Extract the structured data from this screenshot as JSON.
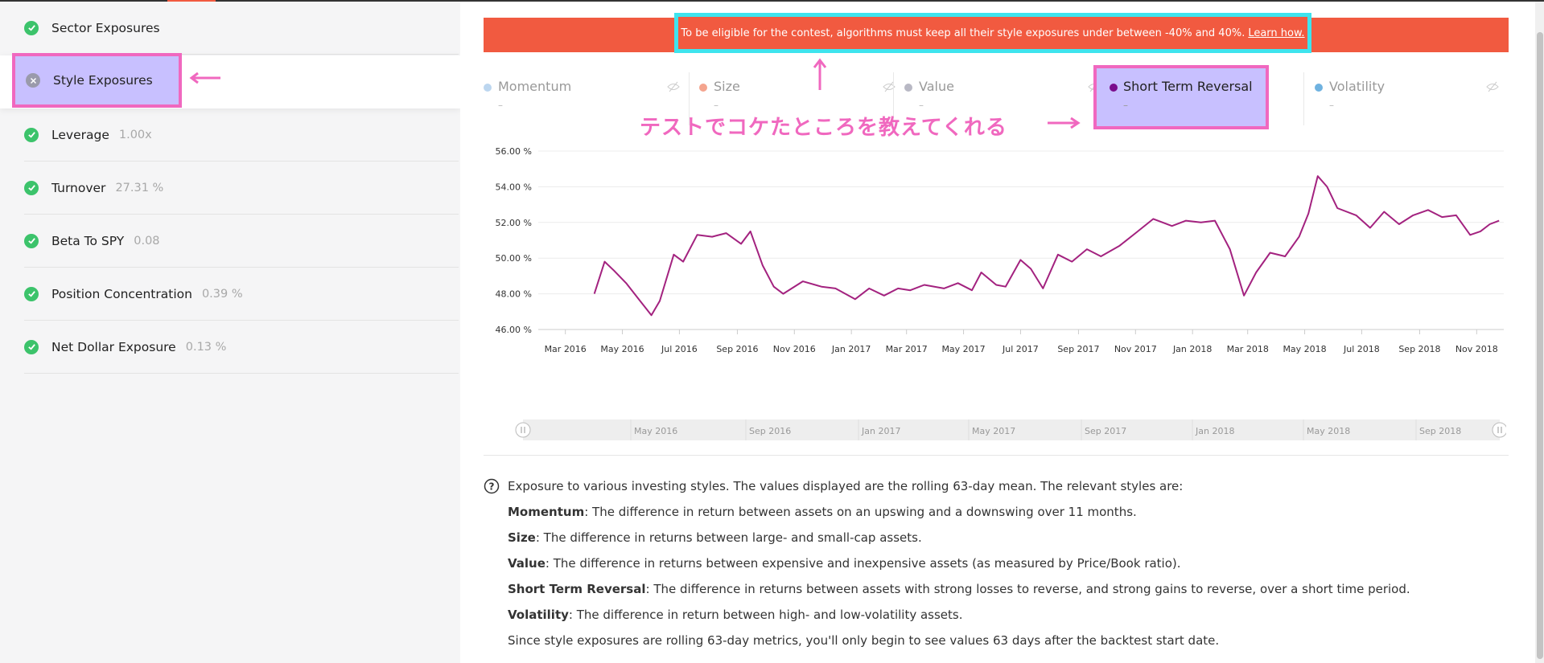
{
  "sidebar": {
    "items": [
      {
        "label": "Sector Exposures",
        "value": ""
      },
      {
        "label": "Style Exposures",
        "value": ""
      },
      {
        "label": "Leverage",
        "value": "1.00x"
      },
      {
        "label": "Turnover",
        "value": "27.31 %"
      },
      {
        "label": "Beta To SPY",
        "value": "0.08"
      },
      {
        "label": "Position Concentration",
        "value": "0.39 %"
      },
      {
        "label": "Net Dollar Exposure",
        "value": "0.13 %"
      }
    ]
  },
  "banner": {
    "text": "To be eligible for the contest, algorithms must keep all their style exposures under between -40% and 40%.",
    "link": "Learn how."
  },
  "tabs": [
    {
      "name": "Momentum",
      "value": "–",
      "color": "#bcd6ef"
    },
    {
      "name": "Size",
      "value": "–",
      "color": "#f4a48e"
    },
    {
      "name": "Value",
      "value": "–",
      "color": "#b8b8c4"
    },
    {
      "name": "Short Term Reversal",
      "value": "–",
      "color": "#7a0c8c"
    },
    {
      "name": "Volatility",
      "value": "–",
      "color": "#6fb2e0"
    }
  ],
  "annotation": {
    "jp_note": "テストでコケたところを教えてくれる"
  },
  "chart_data": {
    "type": "line",
    "title": "",
    "xlabel": "",
    "ylabel": "",
    "ylim": [
      46,
      56
    ],
    "y_ticks": [
      "46.00 %",
      "48.00 %",
      "50.00 %",
      "52.00 %",
      "54.00 %",
      "56.00 %"
    ],
    "x_ticks": [
      "Mar 2016",
      "May 2016",
      "Jul 2016",
      "Sep 2016",
      "Nov 2016",
      "Jan 2017",
      "Mar 2017",
      "May 2017",
      "Jul 2017",
      "Sep 2017",
      "Nov 2017",
      "Jan 2018",
      "Mar 2018",
      "May 2018",
      "Jul 2018",
      "Sep 2018",
      "Nov 2018"
    ],
    "series": [
      {
        "color": "#a3227f",
        "points": [
          [
            "2016-04-01",
            48.0
          ],
          [
            "2016-04-12",
            49.8
          ],
          [
            "2016-04-22",
            49.3
          ],
          [
            "2016-05-05",
            48.6
          ],
          [
            "2016-05-20",
            47.6
          ],
          [
            "2016-06-01",
            46.8
          ],
          [
            "2016-06-10",
            47.6
          ],
          [
            "2016-06-25",
            50.2
          ],
          [
            "2016-07-05",
            49.8
          ],
          [
            "2016-07-20",
            51.3
          ],
          [
            "2016-08-05",
            51.2
          ],
          [
            "2016-08-20",
            51.4
          ],
          [
            "2016-09-05",
            50.8
          ],
          [
            "2016-09-15",
            51.5
          ],
          [
            "2016-09-28",
            49.6
          ],
          [
            "2016-10-10",
            48.4
          ],
          [
            "2016-10-20",
            48.0
          ],
          [
            "2016-11-10",
            48.7
          ],
          [
            "2016-11-30",
            48.4
          ],
          [
            "2016-12-15",
            48.3
          ],
          [
            "2017-01-05",
            47.7
          ],
          [
            "2017-01-20",
            48.3
          ],
          [
            "2017-02-05",
            47.9
          ],
          [
            "2017-02-20",
            48.3
          ],
          [
            "2017-03-05",
            48.2
          ],
          [
            "2017-03-20",
            48.5
          ],
          [
            "2017-04-10",
            48.3
          ],
          [
            "2017-04-25",
            48.6
          ],
          [
            "2017-05-10",
            48.2
          ],
          [
            "2017-05-20",
            49.2
          ],
          [
            "2017-06-05",
            48.5
          ],
          [
            "2017-06-15",
            48.4
          ],
          [
            "2017-07-01",
            49.9
          ],
          [
            "2017-07-12",
            49.4
          ],
          [
            "2017-07-25",
            48.3
          ],
          [
            "2017-08-10",
            50.2
          ],
          [
            "2017-08-25",
            49.8
          ],
          [
            "2017-09-10",
            50.5
          ],
          [
            "2017-09-25",
            50.1
          ],
          [
            "2017-10-15",
            50.7
          ],
          [
            "2017-11-01",
            51.4
          ],
          [
            "2017-11-20",
            52.2
          ],
          [
            "2017-12-10",
            51.8
          ],
          [
            "2017-12-25",
            52.1
          ],
          [
            "2018-01-10",
            52.0
          ],
          [
            "2018-01-25",
            52.1
          ],
          [
            "2018-02-10",
            50.5
          ],
          [
            "2018-02-25",
            47.9
          ],
          [
            "2018-03-10",
            49.2
          ],
          [
            "2018-03-25",
            50.3
          ],
          [
            "2018-04-10",
            50.1
          ],
          [
            "2018-04-25",
            51.2
          ],
          [
            "2018-05-05",
            52.5
          ],
          [
            "2018-05-15",
            54.6
          ],
          [
            "2018-05-25",
            54.0
          ],
          [
            "2018-06-05",
            52.8
          ],
          [
            "2018-06-25",
            52.4
          ],
          [
            "2018-07-10",
            51.7
          ],
          [
            "2018-07-25",
            52.6
          ],
          [
            "2018-08-10",
            51.9
          ],
          [
            "2018-08-25",
            52.4
          ],
          [
            "2018-09-10",
            52.7
          ],
          [
            "2018-09-25",
            52.3
          ],
          [
            "2018-10-10",
            52.4
          ],
          [
            "2018-10-25",
            51.3
          ],
          [
            "2018-11-05",
            51.5
          ],
          [
            "2018-11-15",
            51.9
          ],
          [
            "2018-11-25",
            52.1
          ]
        ]
      }
    ],
    "navigator_labels": [
      "May 2016",
      "Sep 2016",
      "Jan 2017",
      "May 2017",
      "Sep 2017",
      "Jan 2018",
      "May 2018",
      "Sep 2018"
    ]
  },
  "description": {
    "intro": "Exposure to various investing styles. The values displayed are the rolling 63-day mean. The relevant styles are:",
    "styles": [
      {
        "term": "Momentum",
        "text": ": The difference in return between assets on an upswing and a downswing over 11 months."
      },
      {
        "term": "Size",
        "text": ": The difference in returns between large- and small-cap assets."
      },
      {
        "term": "Value",
        "text": ": The difference in returns between expensive and inexpensive assets (as measured by Price/Book ratio)."
      },
      {
        "term": "Short Term Reversal",
        "text": ": The difference in returns between assets with strong losses to reverse, and strong gains to reverse, over a short time period."
      },
      {
        "term": "Volatility",
        "text": ": The difference in return between high- and low-volatility assets."
      }
    ],
    "footer": "Since style exposures are rolling 63-day metrics, you'll only begin to see values 63 days after the backtest start date."
  }
}
